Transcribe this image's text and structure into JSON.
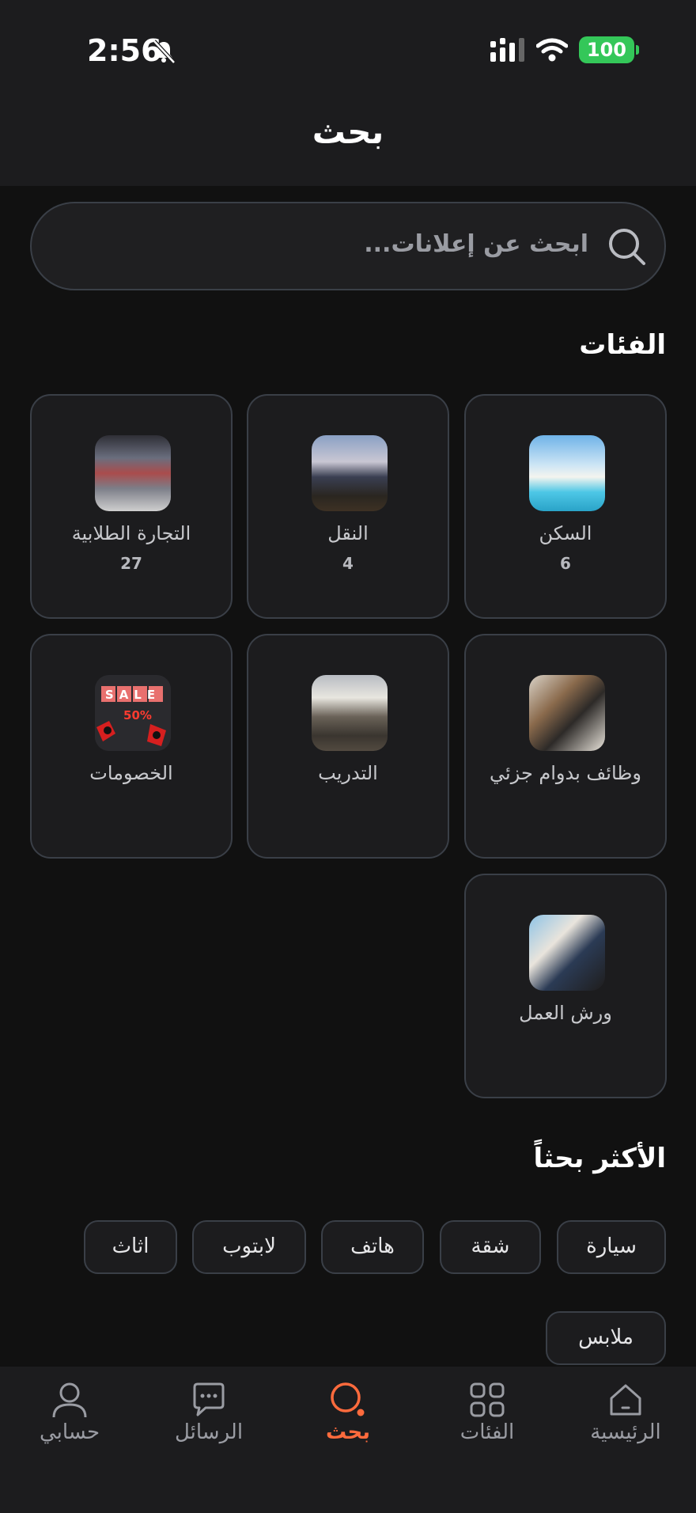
{
  "status_bar": {
    "time": "2:56",
    "battery": "100"
  },
  "header": {
    "title": "بحث"
  },
  "search": {
    "placeholder": "ابحث عن إعلانات..."
  },
  "categories": {
    "title": "الفئات",
    "items": [
      {
        "label": "السكن",
        "count": "6"
      },
      {
        "label": "النقل",
        "count": "4"
      },
      {
        "label": "التجارة الطلابية",
        "count": "27"
      },
      {
        "label": "وظائف بدوام جزئي",
        "count": ""
      },
      {
        "label": "التدريب",
        "count": ""
      },
      {
        "label": "الخصومات",
        "count": ""
      },
      {
        "label": "ورش العمل",
        "count": ""
      }
    ],
    "sale_badge": {
      "text": "SALE",
      "percent": "50%"
    }
  },
  "popular": {
    "title": "الأكثر بحثاً",
    "chips": [
      "سيارة",
      "شقة",
      "هاتف",
      "لابتوب",
      "اثاث",
      "ملابس"
    ]
  },
  "bottom_nav": {
    "items": [
      {
        "label": "الرئيسية",
        "icon": "home-icon"
      },
      {
        "label": "الفئات",
        "icon": "grid-icon"
      },
      {
        "label": "بحث",
        "icon": "search-icon",
        "active": true
      },
      {
        "label": "الرسائل",
        "icon": "chat-icon"
      },
      {
        "label": "حسابي",
        "icon": "user-icon"
      }
    ],
    "active_color": "#ff6b3d"
  }
}
